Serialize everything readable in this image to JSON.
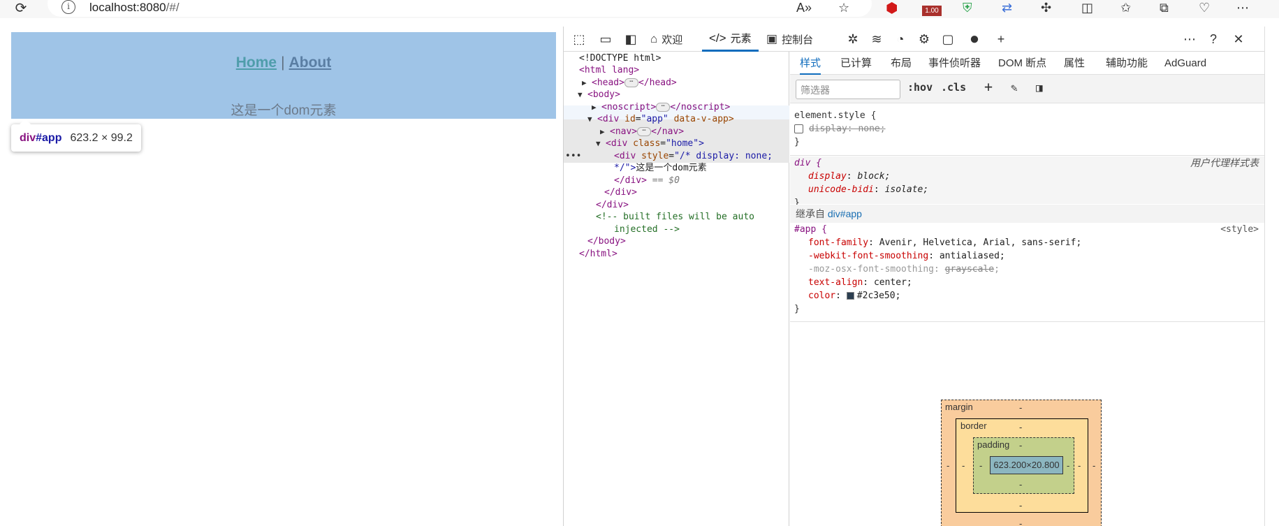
{
  "browser": {
    "url_host": "localhost:8080",
    "url_path": "/#/",
    "badge_value": "1.00"
  },
  "page": {
    "nav_home": "Home",
    "nav_sep": "|",
    "nav_about": "About",
    "dom_text": "这是一个dom元素",
    "tooltip_tag": "div",
    "tooltip_id": "#app",
    "tooltip_size": "623.2 × 99.2"
  },
  "devtools": {
    "tabs": {
      "welcome": "欢迎",
      "elements": "元素",
      "console": "控制台"
    },
    "dom_lines": {
      "doctype": "<!DOCTYPE html>",
      "html_open": "<html lang>",
      "head": "<head>",
      "head_close": "</head>",
      "body_open": "<body>",
      "noscript": "<noscript>",
      "noscript_close": "</noscript>",
      "div_app_open": "<div",
      "div_app_attr": "id",
      "div_app_val": "\"app\"",
      "div_app_attr2": "data-v-app>",
      "nav": "<nav>",
      "nav_close": "</nav>",
      "div_home_open": "<div",
      "div_home_attr": "class",
      "div_home_val": "\"home\">",
      "div_style_open": "<div",
      "div_style_attr": "style",
      "div_style_val1": "\"/* display: none;",
      "div_style_val2": "*/\">",
      "div_style_text": "这是一个dom元素",
      "div_style_close": "</div>",
      "eq_zero": "== $0",
      "div_close1": "</div>",
      "div_close2": "</div>",
      "comment1": "<!-- built files will be auto",
      "comment2": "injected -->",
      "body_close": "</body>",
      "html_close": "</html>"
    },
    "style_tabs": [
      "样式",
      "已计算",
      "布局",
      "事件侦听器",
      "DOM 断点",
      "属性",
      "辅助功能",
      "AdGuard"
    ],
    "filter_placeholder": "筛选器",
    "hov": ":hov",
    "cls": ".cls",
    "rules": {
      "element_style": "element.style {",
      "element_prop": "display: none;",
      "close": "}",
      "div_sel": "div {",
      "ua_label": "用户代理样式表",
      "div_p1_name": "display",
      "div_p1_val": "block;",
      "div_p2_name": "unicode-bidi",
      "div_p2_val": "isolate;",
      "inherit_label": "继承自",
      "inherit_from": "div#app",
      "app_sel": "#app {",
      "app_src": "<style>",
      "app_p1_name": "font-family",
      "app_p1_val": "Avenir, Helvetica, Arial, sans-serif;",
      "app_p2_name": "-webkit-font-smoothing",
      "app_p2_val": "antialiased;",
      "app_p3_name": "-moz-osx-font-smoothing",
      "app_p3_val": "grayscale",
      "app_p4_name": "text-align",
      "app_p4_val": "center;",
      "app_p5_name": "color",
      "app_p5_val": "#2c3e50;"
    },
    "box_model": {
      "margin": "margin",
      "border": "border",
      "padding": "padding",
      "content": "623.200×20.800",
      "dash": "-"
    }
  },
  "colors": {
    "app_bg": "#9fc4e7",
    "text_color": "#2c3e50",
    "accent": "#0f6cbd"
  }
}
